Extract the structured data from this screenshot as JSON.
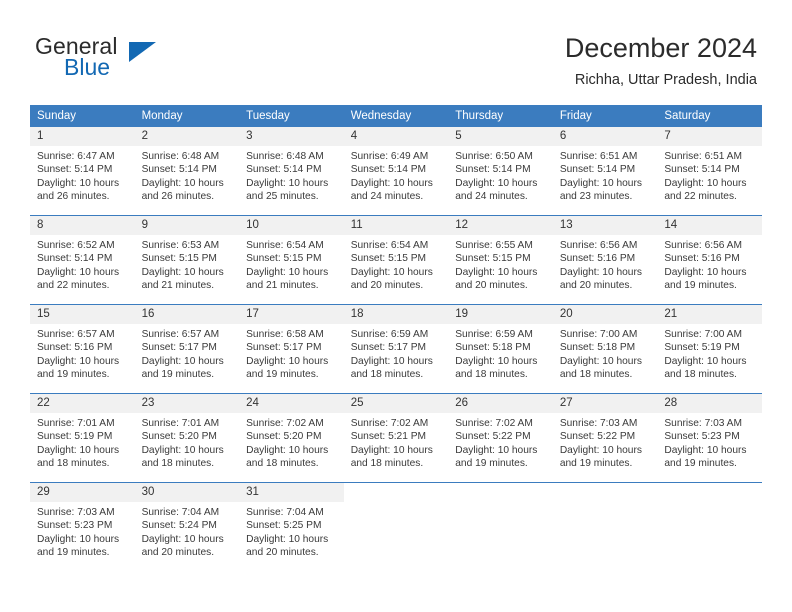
{
  "logo": {
    "word_top": "General",
    "word_bottom": "Blue",
    "accent_color": "#1268b3",
    "triangle_icon": "triangle-logo-icon"
  },
  "header": {
    "title": "December 2024",
    "subtitle": "Richha, Uttar Pradesh, India"
  },
  "theme": {
    "header_bg": "#3b7cbf",
    "daynum_bg": "#f1f1f1",
    "text": "#3a3a3a",
    "row_divider": "#3b7cbf"
  },
  "weekday_headers": [
    "Sunday",
    "Monday",
    "Tuesday",
    "Wednesday",
    "Thursday",
    "Friday",
    "Saturday"
  ],
  "weeks": [
    [
      {
        "day": "1",
        "sunrise": "Sunrise: 6:47 AM",
        "sunset": "Sunset: 5:14 PM",
        "daylight_line1": "Daylight: 10 hours",
        "daylight_line2": "and 26 minutes."
      },
      {
        "day": "2",
        "sunrise": "Sunrise: 6:48 AM",
        "sunset": "Sunset: 5:14 PM",
        "daylight_line1": "Daylight: 10 hours",
        "daylight_line2": "and 26 minutes."
      },
      {
        "day": "3",
        "sunrise": "Sunrise: 6:48 AM",
        "sunset": "Sunset: 5:14 PM",
        "daylight_line1": "Daylight: 10 hours",
        "daylight_line2": "and 25 minutes."
      },
      {
        "day": "4",
        "sunrise": "Sunrise: 6:49 AM",
        "sunset": "Sunset: 5:14 PM",
        "daylight_line1": "Daylight: 10 hours",
        "daylight_line2": "and 24 minutes."
      },
      {
        "day": "5",
        "sunrise": "Sunrise: 6:50 AM",
        "sunset": "Sunset: 5:14 PM",
        "daylight_line1": "Daylight: 10 hours",
        "daylight_line2": "and 24 minutes."
      },
      {
        "day": "6",
        "sunrise": "Sunrise: 6:51 AM",
        "sunset": "Sunset: 5:14 PM",
        "daylight_line1": "Daylight: 10 hours",
        "daylight_line2": "and 23 minutes."
      },
      {
        "day": "7",
        "sunrise": "Sunrise: 6:51 AM",
        "sunset": "Sunset: 5:14 PM",
        "daylight_line1": "Daylight: 10 hours",
        "daylight_line2": "and 22 minutes."
      }
    ],
    [
      {
        "day": "8",
        "sunrise": "Sunrise: 6:52 AM",
        "sunset": "Sunset: 5:14 PM",
        "daylight_line1": "Daylight: 10 hours",
        "daylight_line2": "and 22 minutes."
      },
      {
        "day": "9",
        "sunrise": "Sunrise: 6:53 AM",
        "sunset": "Sunset: 5:15 PM",
        "daylight_line1": "Daylight: 10 hours",
        "daylight_line2": "and 21 minutes."
      },
      {
        "day": "10",
        "sunrise": "Sunrise: 6:54 AM",
        "sunset": "Sunset: 5:15 PM",
        "daylight_line1": "Daylight: 10 hours",
        "daylight_line2": "and 21 minutes."
      },
      {
        "day": "11",
        "sunrise": "Sunrise: 6:54 AM",
        "sunset": "Sunset: 5:15 PM",
        "daylight_line1": "Daylight: 10 hours",
        "daylight_line2": "and 20 minutes."
      },
      {
        "day": "12",
        "sunrise": "Sunrise: 6:55 AM",
        "sunset": "Sunset: 5:15 PM",
        "daylight_line1": "Daylight: 10 hours",
        "daylight_line2": "and 20 minutes."
      },
      {
        "day": "13",
        "sunrise": "Sunrise: 6:56 AM",
        "sunset": "Sunset: 5:16 PM",
        "daylight_line1": "Daylight: 10 hours",
        "daylight_line2": "and 20 minutes."
      },
      {
        "day": "14",
        "sunrise": "Sunrise: 6:56 AM",
        "sunset": "Sunset: 5:16 PM",
        "daylight_line1": "Daylight: 10 hours",
        "daylight_line2": "and 19 minutes."
      }
    ],
    [
      {
        "day": "15",
        "sunrise": "Sunrise: 6:57 AM",
        "sunset": "Sunset: 5:16 PM",
        "daylight_line1": "Daylight: 10 hours",
        "daylight_line2": "and 19 minutes."
      },
      {
        "day": "16",
        "sunrise": "Sunrise: 6:57 AM",
        "sunset": "Sunset: 5:17 PM",
        "daylight_line1": "Daylight: 10 hours",
        "daylight_line2": "and 19 minutes."
      },
      {
        "day": "17",
        "sunrise": "Sunrise: 6:58 AM",
        "sunset": "Sunset: 5:17 PM",
        "daylight_line1": "Daylight: 10 hours",
        "daylight_line2": "and 19 minutes."
      },
      {
        "day": "18",
        "sunrise": "Sunrise: 6:59 AM",
        "sunset": "Sunset: 5:17 PM",
        "daylight_line1": "Daylight: 10 hours",
        "daylight_line2": "and 18 minutes."
      },
      {
        "day": "19",
        "sunrise": "Sunrise: 6:59 AM",
        "sunset": "Sunset: 5:18 PM",
        "daylight_line1": "Daylight: 10 hours",
        "daylight_line2": "and 18 minutes."
      },
      {
        "day": "20",
        "sunrise": "Sunrise: 7:00 AM",
        "sunset": "Sunset: 5:18 PM",
        "daylight_line1": "Daylight: 10 hours",
        "daylight_line2": "and 18 minutes."
      },
      {
        "day": "21",
        "sunrise": "Sunrise: 7:00 AM",
        "sunset": "Sunset: 5:19 PM",
        "daylight_line1": "Daylight: 10 hours",
        "daylight_line2": "and 18 minutes."
      }
    ],
    [
      {
        "day": "22",
        "sunrise": "Sunrise: 7:01 AM",
        "sunset": "Sunset: 5:19 PM",
        "daylight_line1": "Daylight: 10 hours",
        "daylight_line2": "and 18 minutes."
      },
      {
        "day": "23",
        "sunrise": "Sunrise: 7:01 AM",
        "sunset": "Sunset: 5:20 PM",
        "daylight_line1": "Daylight: 10 hours",
        "daylight_line2": "and 18 minutes."
      },
      {
        "day": "24",
        "sunrise": "Sunrise: 7:02 AM",
        "sunset": "Sunset: 5:20 PM",
        "daylight_line1": "Daylight: 10 hours",
        "daylight_line2": "and 18 minutes."
      },
      {
        "day": "25",
        "sunrise": "Sunrise: 7:02 AM",
        "sunset": "Sunset: 5:21 PM",
        "daylight_line1": "Daylight: 10 hours",
        "daylight_line2": "and 18 minutes."
      },
      {
        "day": "26",
        "sunrise": "Sunrise: 7:02 AM",
        "sunset": "Sunset: 5:22 PM",
        "daylight_line1": "Daylight: 10 hours",
        "daylight_line2": "and 19 minutes."
      },
      {
        "day": "27",
        "sunrise": "Sunrise: 7:03 AM",
        "sunset": "Sunset: 5:22 PM",
        "daylight_line1": "Daylight: 10 hours",
        "daylight_line2": "and 19 minutes."
      },
      {
        "day": "28",
        "sunrise": "Sunrise: 7:03 AM",
        "sunset": "Sunset: 5:23 PM",
        "daylight_line1": "Daylight: 10 hours",
        "daylight_line2": "and 19 minutes."
      }
    ],
    [
      {
        "day": "29",
        "sunrise": "Sunrise: 7:03 AM",
        "sunset": "Sunset: 5:23 PM",
        "daylight_line1": "Daylight: 10 hours",
        "daylight_line2": "and 19 minutes."
      },
      {
        "day": "30",
        "sunrise": "Sunrise: 7:04 AM",
        "sunset": "Sunset: 5:24 PM",
        "daylight_line1": "Daylight: 10 hours",
        "daylight_line2": "and 20 minutes."
      },
      {
        "day": "31",
        "sunrise": "Sunrise: 7:04 AM",
        "sunset": "Sunset: 5:25 PM",
        "daylight_line1": "Daylight: 10 hours",
        "daylight_line2": "and 20 minutes."
      },
      {
        "day": "",
        "sunrise": "",
        "sunset": "",
        "daylight_line1": "",
        "daylight_line2": ""
      },
      {
        "day": "",
        "sunrise": "",
        "sunset": "",
        "daylight_line1": "",
        "daylight_line2": ""
      },
      {
        "day": "",
        "sunrise": "",
        "sunset": "",
        "daylight_line1": "",
        "daylight_line2": ""
      },
      {
        "day": "",
        "sunrise": "",
        "sunset": "",
        "daylight_line1": "",
        "daylight_line2": ""
      }
    ]
  ]
}
